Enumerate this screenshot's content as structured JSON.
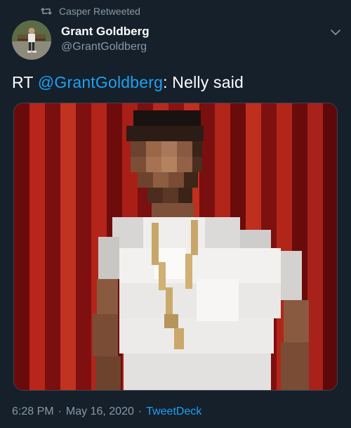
{
  "retweet": {
    "icon": "retweet-icon",
    "label": "Casper Retweeted"
  },
  "author": {
    "display_name": "Grant Goldberg",
    "handle": "@GrantGoldberg",
    "avatar_icon": "avatar"
  },
  "menu_icon": "chevron-down-icon",
  "tweet": {
    "prefix": "RT ",
    "mention": "@GrantGoldberg",
    "rest": ": Nelly said"
  },
  "media": {
    "kind": "pixelated photo"
  },
  "meta": {
    "time": "6:28 PM",
    "separator": "·",
    "date": "May 16, 2020",
    "source": "TweetDeck"
  },
  "colors": {
    "background": "#15202b",
    "secondary_text": "#8899a6",
    "link": "#1da1f2",
    "primary_text": "#ffffff"
  }
}
